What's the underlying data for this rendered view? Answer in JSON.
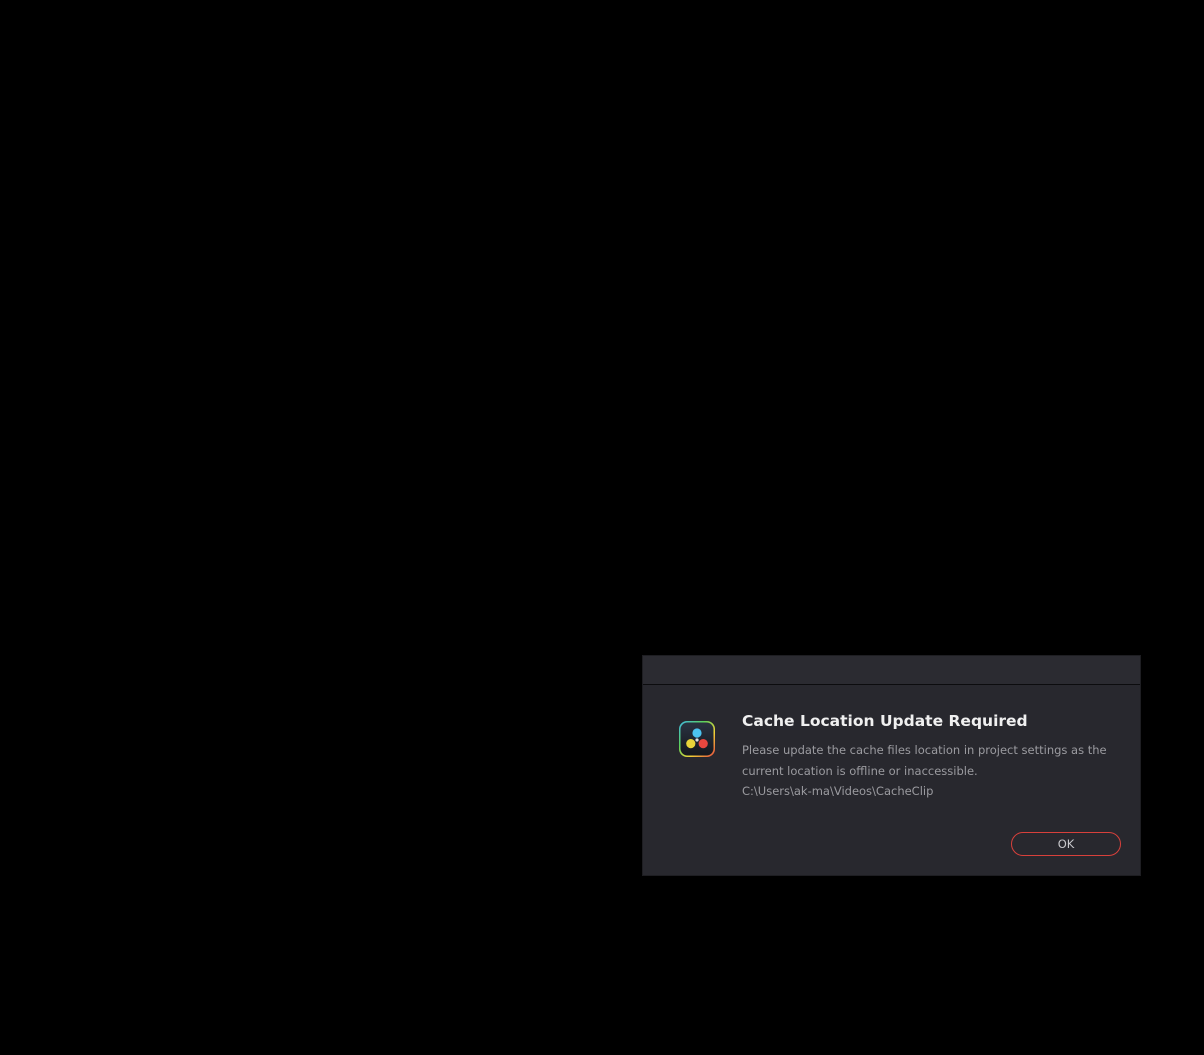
{
  "dialog": {
    "title": "Cache Location Update Required",
    "message": "Please update the cache files location in project settings as the current location is offline or inaccessible.",
    "path": "C:\\Users\\ak-ma\\Videos\\CacheClip",
    "ok_label": "OK",
    "icon": "davinci-resolve-app-icon"
  },
  "colors": {
    "background": "#000000",
    "dialog_bg": "#28282e",
    "button_border": "#d8403b",
    "title_text": "#f0f0f0",
    "body_text": "#9b9ba0"
  }
}
